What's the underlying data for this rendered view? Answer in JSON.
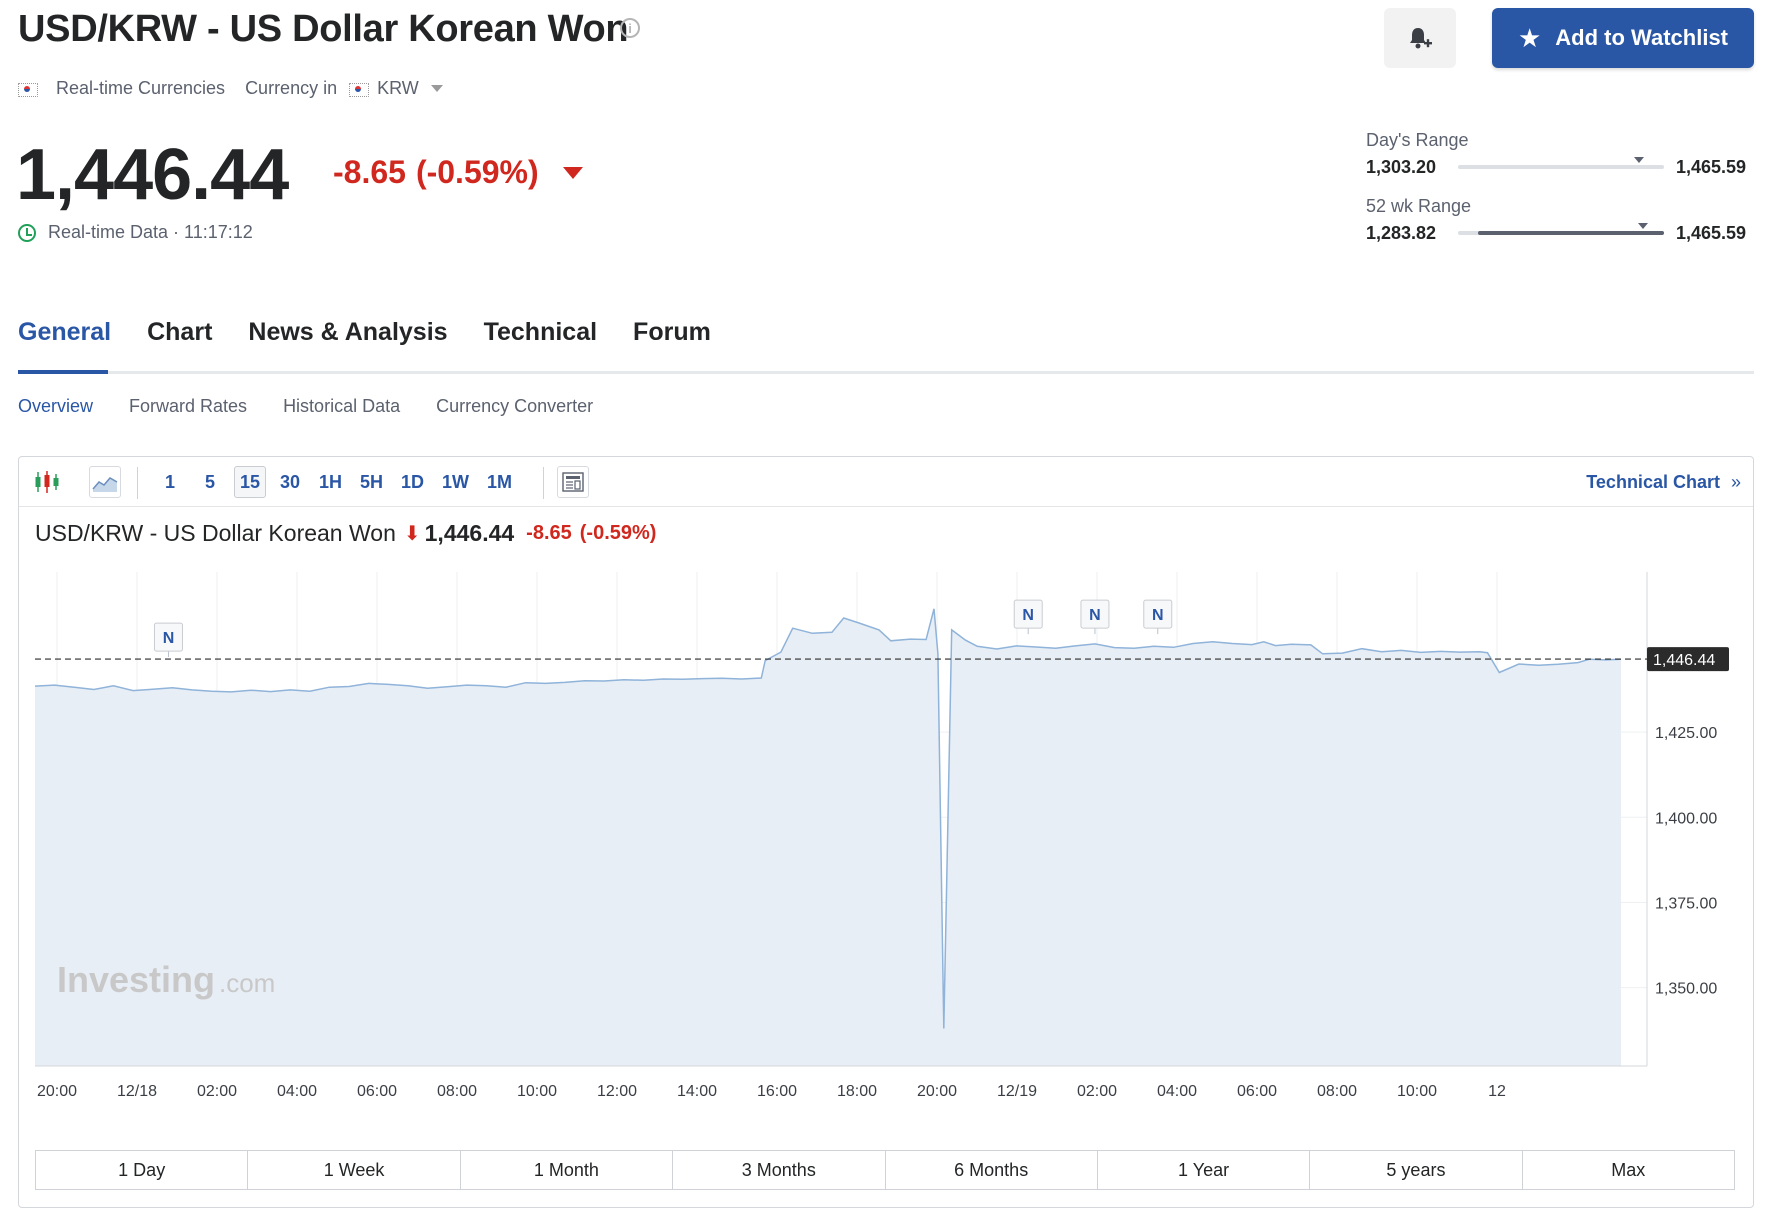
{
  "header": {
    "title": "USD/KRW - US Dollar Korean Won",
    "info_symbol": "i",
    "add_watchlist_label": "Add to Watchlist",
    "meta_market": "Real-time Currencies",
    "meta_currency_label": "Currency in",
    "meta_currency": "KRW"
  },
  "quote": {
    "price": "1,446.44",
    "change": "-8.65",
    "change_pct": "(-0.59%)",
    "realtime_label": "Real-time Data · 11:17:12"
  },
  "ranges": {
    "day": {
      "label": "Day's Range",
      "low": "1,303.20",
      "high": "1,465.59",
      "position_fraction": 0.88
    },
    "wk52": {
      "label": "52 wk Range",
      "low": "1,283.82",
      "high": "1,465.59",
      "position_fraction": 0.9
    }
  },
  "tabs": [
    "General",
    "Chart",
    "News & Analysis",
    "Technical",
    "Forum"
  ],
  "subtabs": [
    "Overview",
    "Forward Rates",
    "Historical Data",
    "Currency Converter"
  ],
  "toolbar": {
    "intervals": [
      "1",
      "5",
      "15",
      "30",
      "1H",
      "5H",
      "1D",
      "1W",
      "1M"
    ],
    "selected_interval": "15",
    "technical_chart_label": "Technical Chart",
    "technical_chart_chevron": "»"
  },
  "chart_header": {
    "name": "USD/KRW - US Dollar Korean Won",
    "price": "1,446.44",
    "change": "-8.65",
    "change_pct": "(-0.59%)"
  },
  "watermark": {
    "brand": "Investing",
    "suffix": ".com"
  },
  "colors": {
    "accent": "#2a56a6",
    "negative": "#d0281e",
    "area_fill": "#e8eef6",
    "line": "#8fb3d9"
  },
  "periods": [
    "1 Day",
    "1 Week",
    "1 Month",
    "3 Months",
    "6 Months",
    "1 Year",
    "5 years",
    "Max"
  ],
  "chart_data": {
    "type": "area",
    "x_tick_labels": [
      "20:00",
      "12/18",
      "02:00",
      "04:00",
      "06:00",
      "08:00",
      "10:00",
      "12:00",
      "14:00",
      "16:00",
      "18:00",
      "20:00",
      "12/19",
      "02:00",
      "04:00",
      "06:00",
      "08:00",
      "10:00",
      "12"
    ],
    "y_tick_labels": [
      "1,425.00",
      "1,400.00",
      "1,375.00",
      "1,350.00"
    ],
    "y_ticks": [
      1425,
      1400,
      1375,
      1350
    ],
    "ylim": [
      1327,
      1472
    ],
    "current_value": 1446.44,
    "current_value_label": "1,446.44",
    "news_marker_label": "N",
    "news_marker_hours": [
      3.4,
      25.3,
      27.0,
      28.6
    ],
    "x_hours_range": [
      0,
      40.4
    ],
    "values": [
      [
        0,
        1438.5
      ],
      [
        0.5,
        1438.8
      ],
      [
        1,
        1438.2
      ],
      [
        1.5,
        1437.5
      ],
      [
        2,
        1438.6
      ],
      [
        2.5,
        1437.2
      ],
      [
        3,
        1437.6
      ],
      [
        3.5,
        1438.0
      ],
      [
        4,
        1437.4
      ],
      [
        4.5,
        1437.0
      ],
      [
        5,
        1436.8
      ],
      [
        5.5,
        1437.3
      ],
      [
        6,
        1436.9
      ],
      [
        6.5,
        1437.4
      ],
      [
        7,
        1437.0
      ],
      [
        7.5,
        1438.2
      ],
      [
        8,
        1438.4
      ],
      [
        8.5,
        1439.3
      ],
      [
        9,
        1439.0
      ],
      [
        9.5,
        1438.6
      ],
      [
        10,
        1437.9
      ],
      [
        10.5,
        1438.3
      ],
      [
        11,
        1438.8
      ],
      [
        11.5,
        1438.6
      ],
      [
        12,
        1438.2
      ],
      [
        12.5,
        1439.5
      ],
      [
        13,
        1439.3
      ],
      [
        13.5,
        1439.6
      ],
      [
        14,
        1440.1
      ],
      [
        14.5,
        1440.0
      ],
      [
        15,
        1440.4
      ],
      [
        15.5,
        1440.2
      ],
      [
        16,
        1440.6
      ],
      [
        16.5,
        1440.5
      ],
      [
        17,
        1440.7
      ],
      [
        17.5,
        1440.8
      ],
      [
        18,
        1440.6
      ],
      [
        18.5,
        1440.9
      ],
      [
        18.6,
        1446.0
      ],
      [
        19,
        1448.5
      ],
      [
        19.3,
        1455.5
      ],
      [
        19.8,
        1454.0
      ],
      [
        20.3,
        1454.3
      ],
      [
        20.6,
        1458.5
      ],
      [
        21,
        1457.0
      ],
      [
        21.5,
        1455.0
      ],
      [
        21.8,
        1451.8
      ],
      [
        22.3,
        1452.3
      ],
      [
        22.7,
        1452.2
      ],
      [
        22.9,
        1461.2
      ],
      [
        23.0,
        1448.0
      ],
      [
        23.15,
        1338.0
      ],
      [
        23.35,
        1455.0
      ],
      [
        23.7,
        1452.0
      ],
      [
        24,
        1450.2
      ],
      [
        24.5,
        1449.4
      ],
      [
        25,
        1450.3
      ],
      [
        25.5,
        1450.0
      ],
      [
        26,
        1449.6
      ],
      [
        26.5,
        1450.3
      ],
      [
        27,
        1450.9
      ],
      [
        27.5,
        1449.8
      ],
      [
        28,
        1449.6
      ],
      [
        28.5,
        1450.2
      ],
      [
        29,
        1449.9
      ],
      [
        29.5,
        1451.0
      ],
      [
        30,
        1451.5
      ],
      [
        30.5,
        1451.0
      ],
      [
        31,
        1450.7
      ],
      [
        31.3,
        1451.5
      ],
      [
        31.6,
        1450.4
      ],
      [
        32,
        1450.8
      ],
      [
        32.5,
        1450.6
      ],
      [
        32.8,
        1448.0
      ],
      [
        33.3,
        1448.2
      ],
      [
        33.8,
        1449.5
      ],
      [
        34.3,
        1448.6
      ],
      [
        34.8,
        1449.0
      ],
      [
        35.3,
        1448.4
      ],
      [
        35.8,
        1448.7
      ],
      [
        36.3,
        1448.5
      ],
      [
        36.8,
        1448.6
      ],
      [
        37.0,
        1448.3
      ],
      [
        37.3,
        1442.5
      ],
      [
        37.8,
        1445.0
      ],
      [
        38.3,
        1444.6
      ],
      [
        38.8,
        1444.9
      ],
      [
        39.3,
        1445.4
      ],
      [
        39.6,
        1446.4
      ],
      [
        40,
        1446.2
      ],
      [
        40.4,
        1446.4
      ]
    ]
  }
}
